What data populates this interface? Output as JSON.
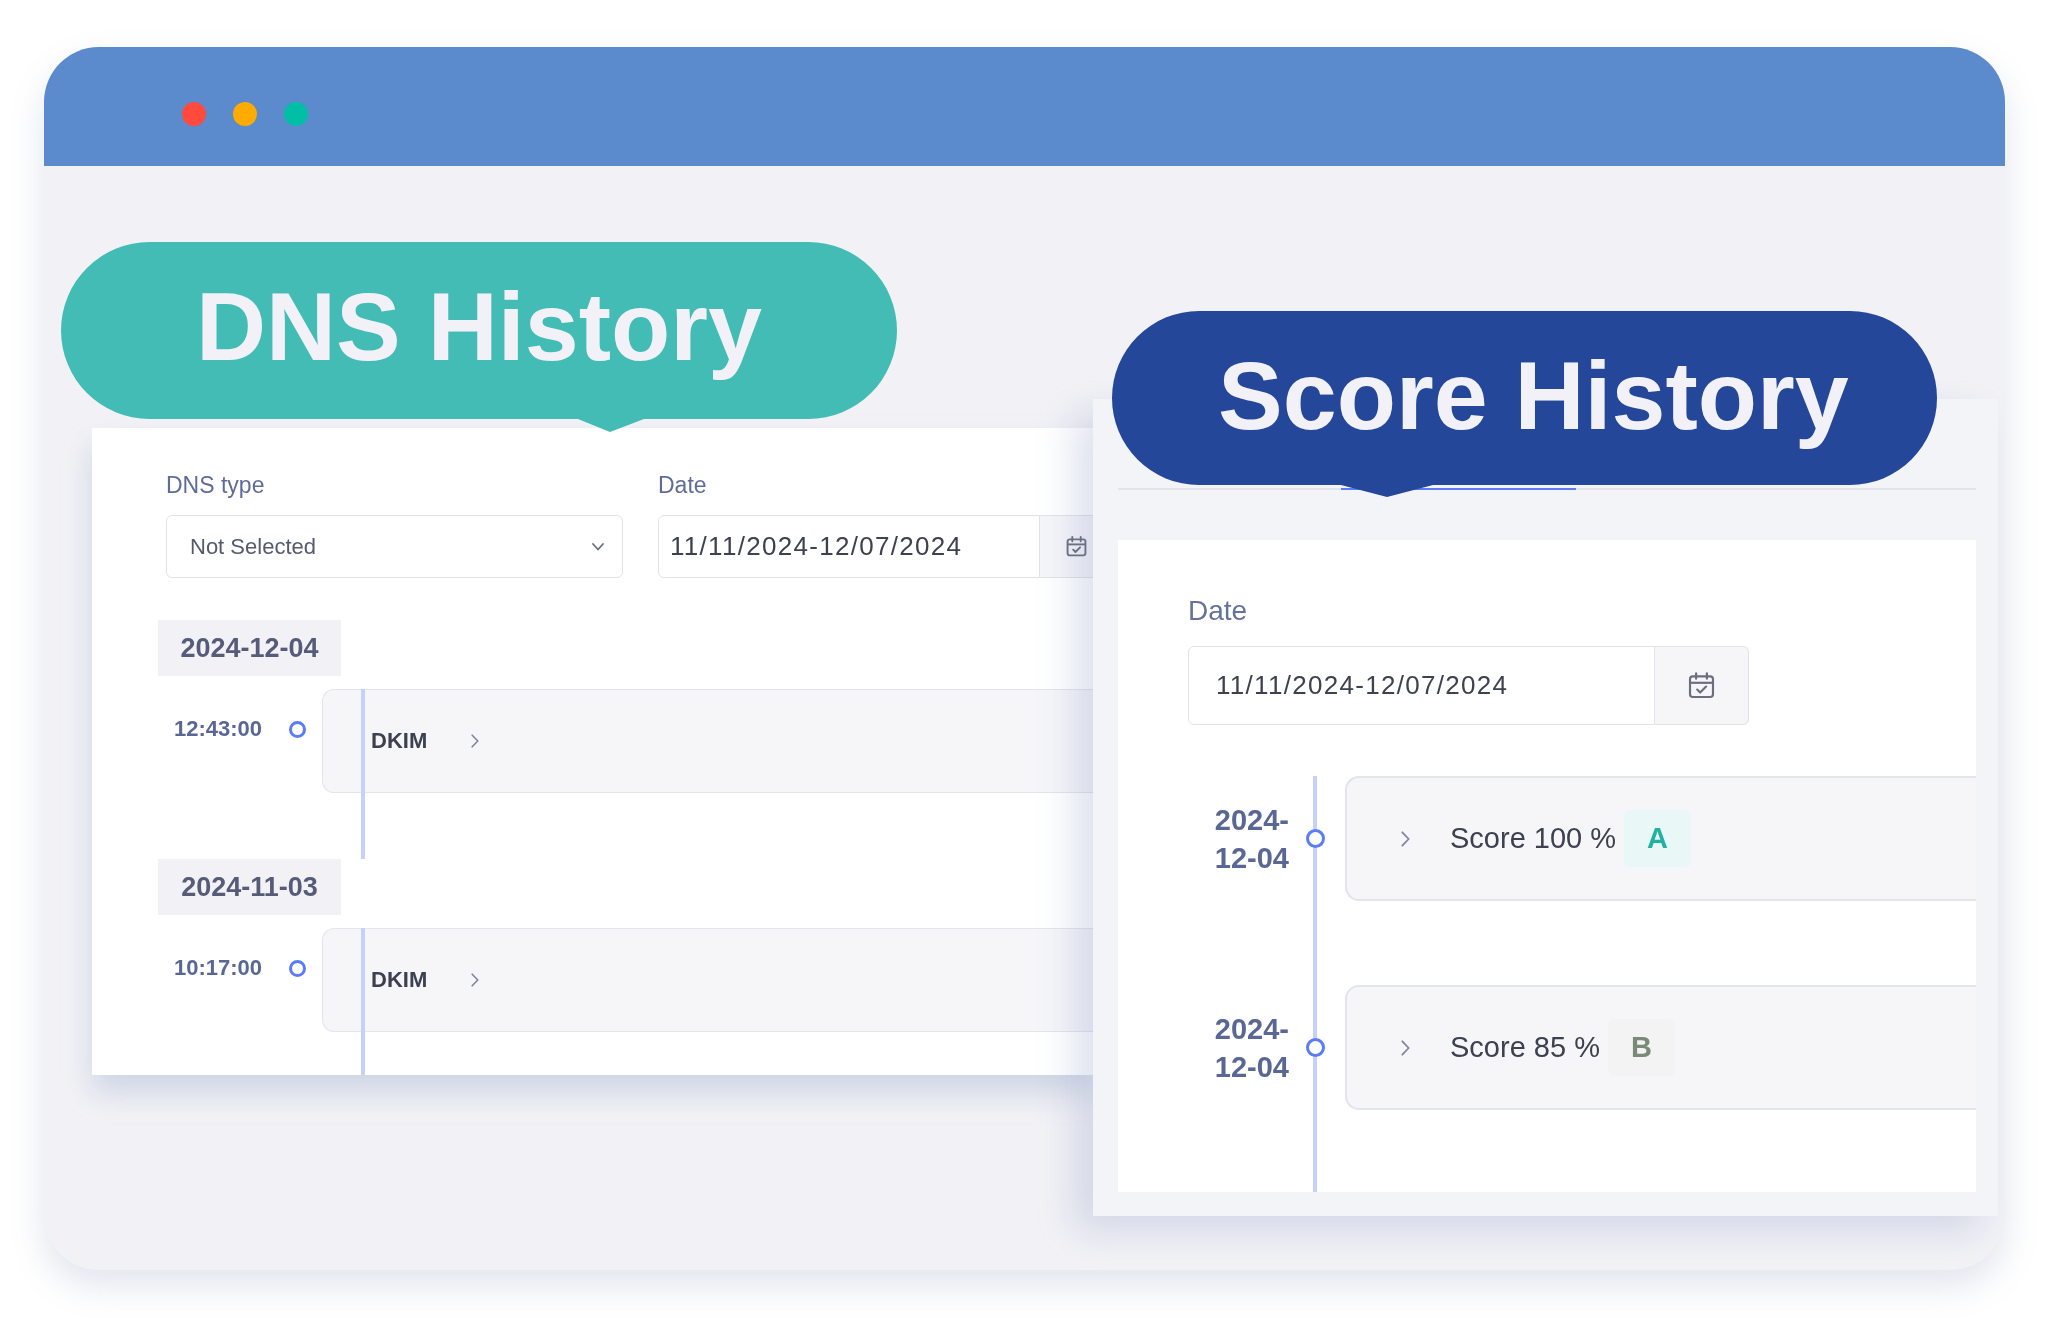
{
  "window": {
    "controls": [
      {
        "color": "#ff4a3d"
      },
      {
        "color": "#ffab00"
      },
      {
        "color": "#00bfa5"
      }
    ]
  },
  "dns_history": {
    "callout": "DNS History",
    "filters": {
      "dns_type": {
        "label": "DNS type",
        "value": "Not Selected"
      },
      "date": {
        "label": "Date",
        "value": "11/11/2024-12/07/2024"
      }
    },
    "groups": [
      {
        "date": "2024-12-04",
        "entries": [
          {
            "time": "12:43:00",
            "record": "DKIM"
          }
        ]
      },
      {
        "date": "2024-11-03",
        "entries": [
          {
            "time": "10:17:00",
            "record": "DKIM"
          }
        ]
      }
    ]
  },
  "score_history": {
    "callout": "Score History",
    "date": {
      "label": "Date",
      "value": "11/11/2024-12/07/2024"
    },
    "entries": [
      {
        "date": "2024-12-04",
        "score": "Score 100 %",
        "grade": "A",
        "color": "#22b2a2"
      },
      {
        "date": "2024-12-04",
        "score": "Score 85 %",
        "grade": "B",
        "color": "#7b8a78"
      }
    ]
  }
}
